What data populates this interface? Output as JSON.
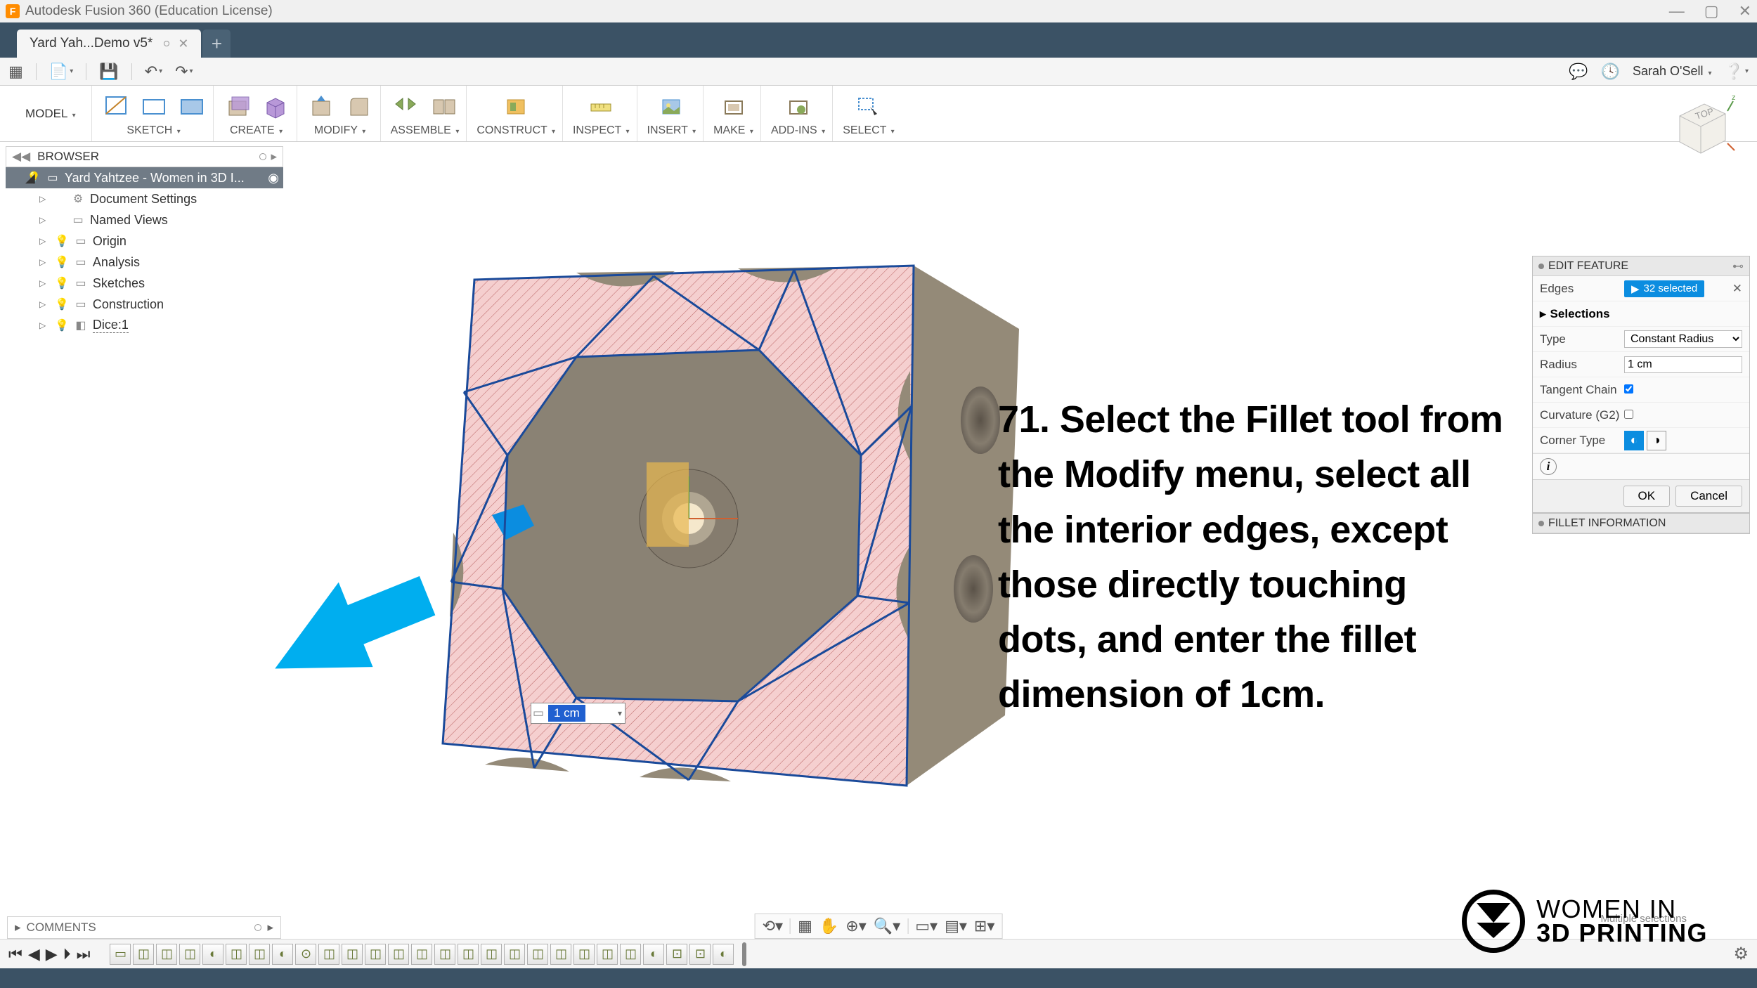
{
  "app": {
    "title": "Autodesk Fusion 360 (Education License)",
    "icon_letter": "F"
  },
  "tabs": [
    {
      "label": "Yard Yah...Demo v5*"
    }
  ],
  "quick": {
    "user": "Sarah O'Sell"
  },
  "ribbon": {
    "model_label": "MODEL",
    "groups": [
      {
        "label": "SKETCH"
      },
      {
        "label": "CREATE"
      },
      {
        "label": "MODIFY"
      },
      {
        "label": "ASSEMBLE"
      },
      {
        "label": "CONSTRUCT"
      },
      {
        "label": "INSPECT"
      },
      {
        "label": "INSERT"
      },
      {
        "label": "MAKE"
      },
      {
        "label": "ADD-INS"
      },
      {
        "label": "SELECT"
      }
    ]
  },
  "browser": {
    "title": "BROWSER",
    "root": "Yard Yahtzee - Women in 3D I...",
    "items": [
      {
        "label": "Document Settings",
        "bulb": false,
        "icon": "⚙"
      },
      {
        "label": "Named Views",
        "bulb": false,
        "icon": "▭"
      },
      {
        "label": "Origin",
        "bulb": true,
        "icon": "▭"
      },
      {
        "label": "Analysis",
        "bulb": true,
        "icon": "▭"
      },
      {
        "label": "Sketches",
        "bulb": true,
        "icon": "▭"
      },
      {
        "label": "Construction",
        "bulb": true,
        "icon": "▭"
      },
      {
        "label": "Dice:1",
        "bulb": true,
        "icon": "◧",
        "selected": true
      }
    ]
  },
  "dim_input": {
    "value": "1 cm"
  },
  "rpanel": {
    "title": "EDIT FEATURE",
    "edges_label": "Edges",
    "edges_selected": "32 selected",
    "selections_label": "Selections",
    "type_label": "Type",
    "type_value": "Constant Radius",
    "radius_label": "Radius",
    "radius_value": "1 cm",
    "tangent_label": "Tangent Chain",
    "curvature_label": "Curvature (G2)",
    "corner_label": "Corner Type",
    "ok": "OK",
    "cancel": "Cancel",
    "info_title": "FILLET INFORMATION"
  },
  "instruction": {
    "text": "71. Select the Fillet tool from the Modify menu, select all the interior edges, except those directly touching dots, and enter the fillet dimension of 1cm."
  },
  "comments": {
    "title": "COMMENTS"
  },
  "viewcube": {
    "face": "TOP"
  },
  "logo": {
    "line1": "WOMEN IN",
    "line2": "3D PRINTING"
  },
  "status": {
    "text": "Multiple selections"
  }
}
